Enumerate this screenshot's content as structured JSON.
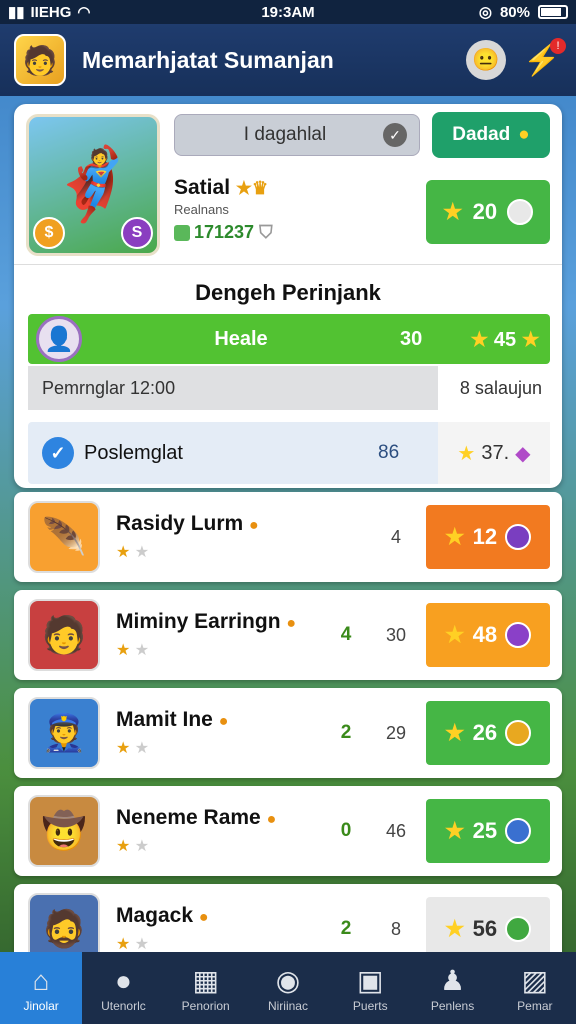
{
  "status_bar": {
    "carrier": "IIEHG",
    "time": "19:3AM",
    "battery": "80%"
  },
  "header": {
    "title": "Memarhjatat Sumanjan"
  },
  "profile": {
    "search_text": "I dagahlal",
    "deal_label": "Dadad",
    "name": "Satial",
    "subtitle": "Realnans",
    "id": "171237",
    "score": "20"
  },
  "leaderboard": {
    "title": "Dengeh Perinjank",
    "top": {
      "name": "Heale",
      "num": "30",
      "score": "45"
    },
    "timer": {
      "label": "Pemrnglar 12:00",
      "right": "8 salaujun"
    },
    "me": {
      "name": "Poslemglat",
      "num": "86",
      "score": "37."
    }
  },
  "rows": [
    {
      "name": "Rasidy Lurm",
      "c1": "",
      "c2": "4",
      "score": "12",
      "color": "#f27a20",
      "gem": "#7a3ec0",
      "icon_bg": "#f8a030",
      "stars": 1
    },
    {
      "name": "Miminy Earringn",
      "c1": "4",
      "c2": "30",
      "score": "48",
      "color": "#f8a020",
      "gem": "#8a40c8",
      "icon_bg": "#c84040",
      "stars": 1
    },
    {
      "name": "Mamit Ine",
      "c1": "2",
      "c2": "29",
      "score": "26",
      "color": "#45b645",
      "gem": "#e8a820",
      "icon_bg": "#3a80d0",
      "stars": 1
    },
    {
      "name": "Neneme Rame",
      "c1": "0",
      "c2": "46",
      "score": "25",
      "color": "#45b645",
      "gem": "#3a70d0",
      "icon_bg": "#c88a40",
      "stars": 1
    },
    {
      "name": "Magack",
      "c1": "2",
      "c2": "8",
      "score": "56",
      "color": "#e8e8e8",
      "gem": "#40a840",
      "icon_bg": "#4a70b0",
      "stars": 1
    }
  ],
  "nav": [
    {
      "label": "Jinolar",
      "icon": "home-icon"
    },
    {
      "label": "Utenorlc",
      "icon": "user-icon"
    },
    {
      "label": "Penorion",
      "icon": "calendar-icon"
    },
    {
      "label": "Niriinac",
      "icon": "palette-icon"
    },
    {
      "label": "Puerts",
      "icon": "cards-icon"
    },
    {
      "label": "Penlens",
      "icon": "profile-icon"
    },
    {
      "label": "Pemar",
      "icon": "image-icon"
    }
  ]
}
